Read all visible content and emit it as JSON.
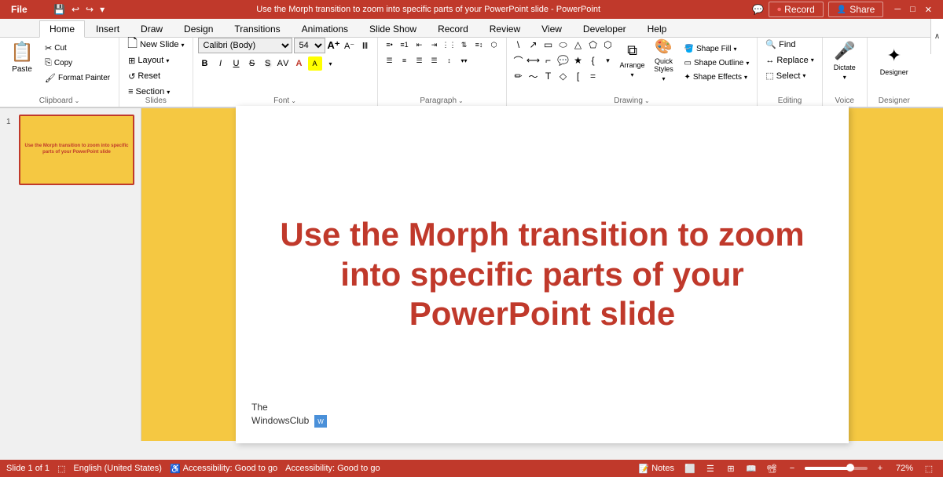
{
  "app": {
    "title": "PowerPoint - Use the Morph transition to zoom into specific parts of your PowerPoint slide",
    "record_label": "Record",
    "share_label": "Share"
  },
  "title_bar": {
    "filename": "Use the Morph transition to zoom into specific parts of your PowerPoint slide - PowerPoint",
    "window_controls": [
      "minimize",
      "maximize",
      "close"
    ],
    "qat_items": [
      "save",
      "undo",
      "redo",
      "customize"
    ]
  },
  "ribbon": {
    "tabs": [
      {
        "id": "file",
        "label": "File",
        "active": false
      },
      {
        "id": "home",
        "label": "Home",
        "active": true
      },
      {
        "id": "insert",
        "label": "Insert",
        "active": false
      },
      {
        "id": "draw",
        "label": "Draw",
        "active": false
      },
      {
        "id": "design",
        "label": "Design",
        "active": false
      },
      {
        "id": "transitions",
        "label": "Transitions",
        "active": false
      },
      {
        "id": "animations",
        "label": "Animations",
        "active": false
      },
      {
        "id": "slideshow",
        "label": "Slide Show",
        "active": false
      },
      {
        "id": "record",
        "label": "Record",
        "active": false
      },
      {
        "id": "review",
        "label": "Review",
        "active": false
      },
      {
        "id": "view",
        "label": "View",
        "active": false
      },
      {
        "id": "developer",
        "label": "Developer",
        "active": false
      },
      {
        "id": "help",
        "label": "Help",
        "active": false
      }
    ],
    "groups": {
      "clipboard": {
        "label": "Clipboard",
        "paste_label": "Paste",
        "buttons": [
          "Cut",
          "Copy",
          "Format Painter"
        ]
      },
      "slides": {
        "label": "Slides",
        "buttons": [
          "New Slide",
          "Layout",
          "Reset",
          "Section"
        ]
      },
      "font": {
        "label": "Font",
        "font_name": "Calibri (Body)",
        "font_size": "54",
        "size_increase": "A",
        "size_decrease": "A",
        "clear_format": "A",
        "format_buttons": [
          "B",
          "I",
          "U",
          "S",
          "ab",
          "A",
          "A"
        ],
        "expand_icon": "⌄"
      },
      "paragraph": {
        "label": "Paragraph",
        "buttons": [
          "bullets",
          "numbered",
          "indent-less",
          "indent-more",
          "line-spacing",
          "left",
          "center",
          "right",
          "justify",
          "columns",
          "text-dir"
        ],
        "expand_icon": "⌄"
      },
      "drawing": {
        "label": "Drawing",
        "shapes": [
          "line",
          "arrow",
          "rectangle",
          "oval",
          "triangle",
          "pentagon",
          "hexagon",
          "callout",
          "connector"
        ],
        "arrange_label": "Arrange",
        "quick_styles_label": "Quick Styles",
        "shape_fill_label": "Shape Fill",
        "shape_outline_label": "Shape Outline",
        "shape_effects_label": "Shape Effects",
        "expand_icon": "⌄"
      },
      "editing": {
        "label": "Editing",
        "find_label": "Find",
        "replace_label": "Replace",
        "select_label": "Select",
        "expand_icon": "⌄"
      },
      "voice": {
        "label": "Voice",
        "dictate_label": "Dictate",
        "expand_icon": "⌄"
      },
      "designer": {
        "label": "Designer",
        "designer_label": "Designer"
      }
    }
  },
  "slides_panel": {
    "slides": [
      {
        "number": 1,
        "text": "Use the Morph transition to zoom into specific parts of your PowerPoint slide"
      }
    ]
  },
  "slide": {
    "main_text": "Use the Morph transition to zoom into specific parts of your PowerPoint slide",
    "watermark_line1": "The",
    "watermark_line2": "WindowsClub"
  },
  "status_bar": {
    "slide_info": "Slide 1 of 1",
    "language": "English (United States)",
    "accessibility": "Accessibility: Good to go",
    "notes_label": "Notes",
    "zoom_percent": "72%",
    "view_buttons": [
      "normal",
      "outline",
      "slide-sorter",
      "reading",
      "presenter"
    ]
  }
}
